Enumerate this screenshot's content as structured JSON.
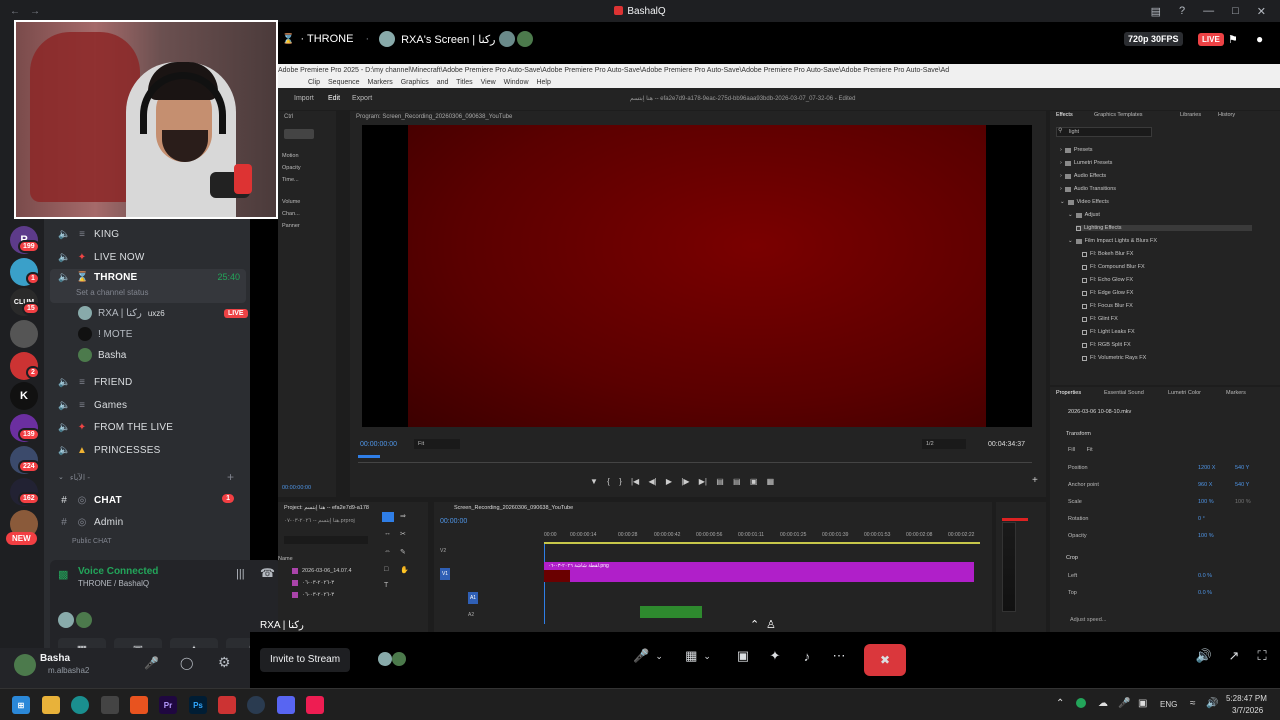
{
  "window": {
    "title": "BashalQ"
  },
  "stream_header": {
    "channel_label": "THRONE",
    "screen_label": "RXA's Screen | رکنا",
    "quality": "720p 30FPS",
    "live": "LIVE"
  },
  "sidebar": {
    "channels": [
      {
        "name": "KING",
        "icon": "speaker-icon"
      },
      {
        "name": "LIVE NOW",
        "icon": "speaker-icon"
      },
      {
        "name": "THRONE",
        "icon": "speaker-icon",
        "timer": "25:40",
        "status": "Set a channel status"
      },
      {
        "name": "FRIEND",
        "icon": "speaker-icon"
      },
      {
        "name": "Games",
        "icon": "speaker-icon"
      },
      {
        "name": "FROM THE LIVE",
        "icon": "speaker-icon"
      },
      {
        "name": "PRINCESSES",
        "icon": "speaker-icon"
      }
    ],
    "vc_users": [
      {
        "name": "RXA | رکنا",
        "tag": "uxz6",
        "live": "LIVE"
      },
      {
        "name": "! MOTE"
      },
      {
        "name": "Basha"
      }
    ],
    "category": "الآباء -",
    "text_channels": [
      {
        "name": "CHAT",
        "badge": "1"
      },
      {
        "name": "Admin"
      }
    ],
    "category2": "Public CHAT"
  },
  "servers": {
    "badges": [
      "199",
      "1",
      "15",
      "2",
      "139",
      "224",
      "162"
    ],
    "k_label": "K",
    "new_label": "NEW",
    "clum_label": "CLUM"
  },
  "voice": {
    "status": "Voice Connected",
    "location": "THRONE / BashalQ"
  },
  "user": {
    "name": "Basha",
    "handle": "m.albasha2"
  },
  "controls": {
    "invite": "Invite to Stream",
    "overlay_name": "RXA | رکنا"
  },
  "premiere": {
    "title_path": "Adobe Premiere Pro 2025 - D:\\my channel\\Minecraft\\Adobe Premiere Pro Auto-Save\\Adobe Premiere Pro Auto-Save\\Adobe Premiere Pro Auto-Save\\Adobe Premiere Pro Auto-Save\\Adobe Premiere Pro Auto-Save\\Ad",
    "menu": [
      "Clip",
      "Sequence",
      "Markers",
      "Graphics and Titles",
      "View",
      "Window",
      "Help"
    ],
    "workspace_tabs": [
      "Import",
      "Edit",
      "Export"
    ],
    "doc_title": "هنا إبتسم -- efa2e7d9-a178-9eac-275d-bb96aaa93bdb-2026-03-07_07-32-06 - Edited",
    "program_label": "Program: Screen_Recording_20260306_090638_YouTube",
    "timecode_in": "00:00:00:00",
    "fit": "Fit",
    "ratio": "1/2",
    "timecode_out": "00:04:34:37",
    "effects_tabs": [
      "Effects",
      "Graphics Templates",
      "Libraries",
      "History"
    ],
    "search_value": "light",
    "effects_tree": [
      "Presets",
      "Lumetri Presets",
      "Audio Effects",
      "Audio Transitions",
      "Video Effects",
      "Adjust",
      "Lighting Effects",
      "Film Impact Lights & Blurs FX",
      "FI: Bokeh Blur FX",
      "FI: Compound Blur FX",
      "FI: Echo Glow FX",
      "FI: Edge Glow FX",
      "FI: Focus Blur FX",
      "FI: Glint FX",
      "FI: Light Leaks FX",
      "FI: RGB Split FX",
      "FI: Volumetric Rays FX"
    ],
    "props_tabs": [
      "Properties",
      "Essential Sound",
      "Lumetri Color",
      "Markers"
    ],
    "props_clip": "2026-03-06 10-08-10.mkv",
    "transform": "Transform",
    "fill": "Fill",
    "fit2": "Fit",
    "props": [
      {
        "label": "Position",
        "v1": "1200 X",
        "v2": "540 Y"
      },
      {
        "label": "Anchor point",
        "v1": "960 X",
        "v2": "540 Y"
      },
      {
        "label": "Scale",
        "v1": "100 %",
        "v2": "100 %"
      },
      {
        "label": "Rotation",
        "v1": "0 °",
        "v2": ""
      },
      {
        "label": "Opacity",
        "v1": "100 %",
        "v2": ""
      }
    ],
    "crop": "Crop",
    "crop_props": [
      {
        "label": "Left",
        "v1": "0.0 %"
      },
      {
        "label": "Top",
        "v1": "0.0 %"
      }
    ],
    "adjust_speed": "Adjust speed...",
    "effect_controls": [
      "Motion",
      "Opacity",
      "Time...",
      "Volume",
      "Chan...",
      "Panner"
    ],
    "project_label": "Project: هنا إبتسم -- efa2e7d9-a178",
    "project_file": "هنا إبتسم -- ٢٠٢٦-٠٣-٠٧.prproj",
    "project_col": "Name",
    "project_items": [
      "2026-03-06_14.07.4",
      "٣-٢٠٢٦-٠٣-٠٦",
      "٣-٢٠٢٦-٠٣-٠٦"
    ],
    "seq_label": "Screen_Recording_20260306_090638_YouTube",
    "seq_timecode": "00:00:00",
    "ruler": [
      "00:00",
      "00:00:00:14",
      "00:00:28",
      "00:00:00:42",
      "00:00:00:56",
      "00:00:01:11",
      "00:00:01:25",
      "00:00:01:39",
      "00:00:01:53",
      "00:00:02:08",
      "00:00:02:22"
    ],
    "clip_name": "لقطة شاشة ٢٠٢٦-٠٣-٠٦.png",
    "tracks": [
      "V2",
      "V1",
      "A1",
      "A2"
    ],
    "small_timecode": "00:00:00:00"
  },
  "taskbar": {
    "lang": "ENG",
    "time": "5:28:47 PM",
    "date": "3/7/2026"
  },
  "colors": {
    "discord_bg": "#2b2d31",
    "rail_bg": "#1e1f22",
    "live_red": "#ed4245",
    "voice_green": "#23a55a",
    "accent_blue": "#2f7ee6",
    "clip_purple": "#b01fc9",
    "video_red": "#6a0000"
  }
}
